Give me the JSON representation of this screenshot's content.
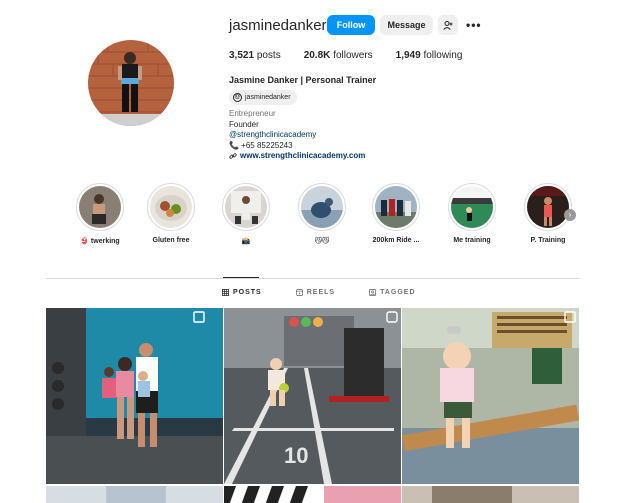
{
  "profile": {
    "username": "jasminedanker",
    "follow_label": "Follow",
    "message_label": "Message",
    "more_label": "•••",
    "stats": {
      "posts_count": "3,521",
      "posts_label": "posts",
      "followers_count": "20.8K",
      "followers_label": "followers",
      "following_count": "1,949",
      "following_label": "following"
    },
    "full_name": "Jasmine Danker | Personal Trainer",
    "threads_handle": "jasminedanker",
    "category": "Entrepreneur",
    "bio_line1": "Founder",
    "bio_mention": "@strengthclinicacademy",
    "bio_phone": "📞 +65 85225243",
    "website": "www.strengthclinicacademy.com"
  },
  "highlights": [
    {
      "label": "👙 twerking"
    },
    {
      "label": "Gluten free"
    },
    {
      "label": "📸"
    },
    {
      "label": "😼😼"
    },
    {
      "label": "200km Ride ..."
    },
    {
      "label": "Me training"
    },
    {
      "label": "P. Training"
    }
  ],
  "tabs": [
    {
      "label": "POSTS",
      "icon": "grid-icon",
      "active": true
    },
    {
      "label": "REELS",
      "icon": "reels-icon",
      "active": false
    },
    {
      "label": "TAGGED",
      "icon": "tagged-icon",
      "active": false
    }
  ],
  "colors": {
    "accent": "#0095f6",
    "link": "#00376b",
    "text": "#262626",
    "muted": "#737373"
  }
}
